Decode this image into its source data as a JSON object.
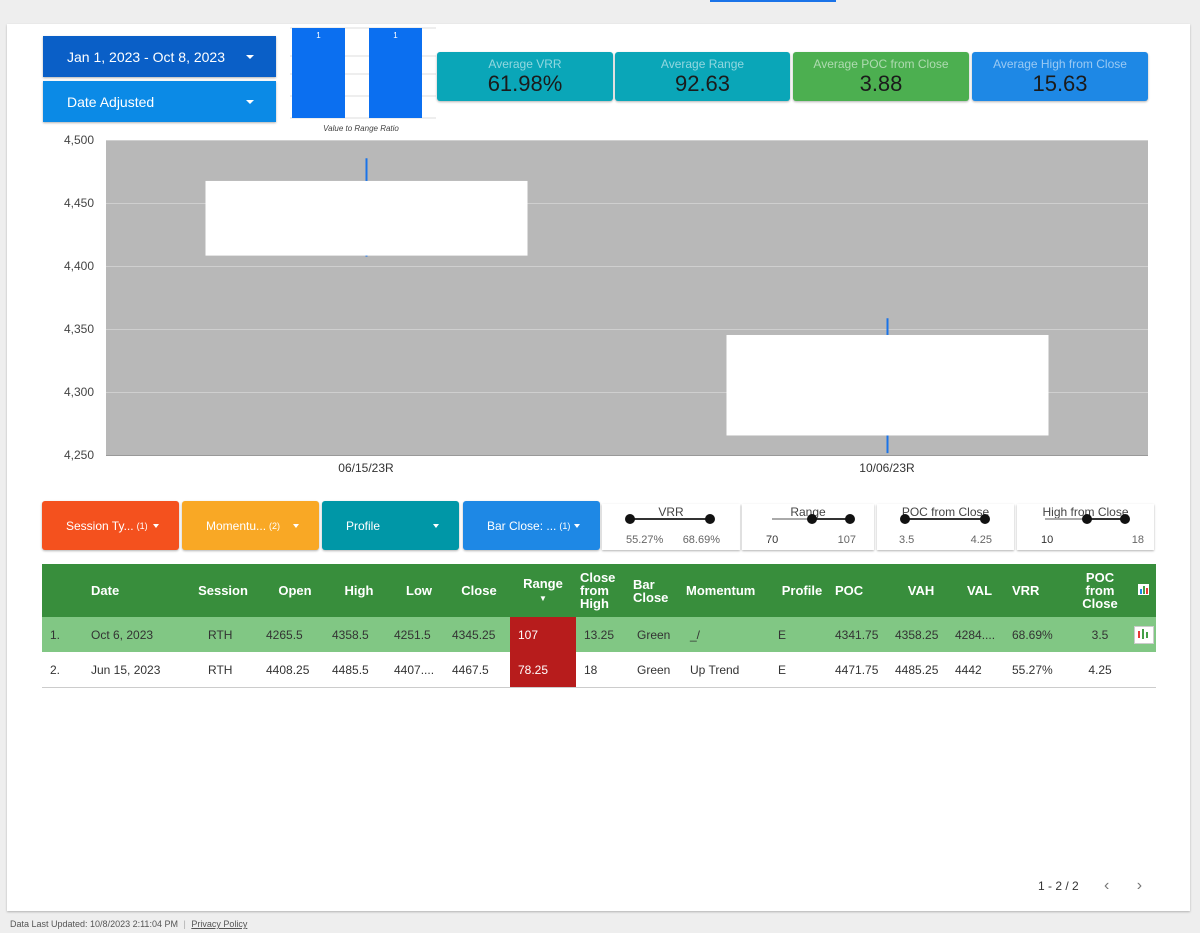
{
  "date_range": {
    "label": "Jan 1, 2023 - Oct 8, 2023"
  },
  "date_adjusted": {
    "label": "Date Adjusted"
  },
  "mini_chart": {
    "caption": "Value to Range Ratio",
    "bars": [
      {
        "label": "1",
        "value": 1
      },
      {
        "label": "1",
        "value": 1
      }
    ],
    "color": "#0b6ff0"
  },
  "kpis": [
    {
      "label": "Average VRR",
      "value": "61.98%",
      "color": "#0aa6b8"
    },
    {
      "label": "Average Range",
      "value": "92.63",
      "color": "#0aa6b8"
    },
    {
      "label": "Average POC from Close",
      "value": "3.88",
      "color": "#4caf50"
    },
    {
      "label": "Average High from Close",
      "value": "15.63",
      "color": "#1e88e5"
    }
  ],
  "chart_data": {
    "type": "candlestick",
    "categories": [
      "06/15/23R",
      "10/06/23R"
    ],
    "candles": [
      {
        "x": "06/15/23R",
        "open": 4408.25,
        "high": 4485.5,
        "low": 4407.5,
        "close": 4467.5
      },
      {
        "x": "10/06/23R",
        "open": 4265.5,
        "high": 4358.5,
        "low": 4251.5,
        "close": 4345.25
      }
    ],
    "yticks": [
      "4,500",
      "4,450",
      "4,400",
      "4,350",
      "4,300",
      "4,250"
    ],
    "ylim": [
      4250,
      4500
    ],
    "background": "#b8b8b8",
    "body_color": "#ffffff",
    "wick_color": "#1a73e8",
    "grid": true
  },
  "filters": [
    {
      "label": "Session Ty...",
      "count": "(1)",
      "color": "#f4511e"
    },
    {
      "label": "Momentu...",
      "count": "(2)",
      "color": "#f9a825"
    },
    {
      "label": "Profile",
      "count": "",
      "color": "#0097a7"
    },
    {
      "label": "Bar Close: ...",
      "count": "(1)",
      "color": "#1e88e5"
    }
  ],
  "sliders": [
    {
      "title": "VRR",
      "min": "55.27%",
      "max": "68.69%",
      "low_frac": 0.0,
      "high_frac": 1.0
    },
    {
      "title": "Range",
      "min": "70",
      "max": "107",
      "low_frac": 0.5,
      "high_frac": 1.0
    },
    {
      "title": "POC from Close",
      "min": "3.5",
      "max": "4.25",
      "low_frac": 0.0,
      "high_frac": 1.0
    },
    {
      "title": "High from Close",
      "min": "10",
      "max": "18",
      "low_frac": 0.5,
      "high_frac": 1.0
    }
  ],
  "table": {
    "headers": [
      "",
      "Date",
      "Session",
      "Open",
      "High",
      "Low",
      "Close",
      "Range",
      "Close from High",
      "Bar Close",
      "Momentum",
      "Profile",
      "POC",
      "VAH",
      "VAL",
      "VRR",
      "POC from Close",
      ""
    ],
    "rows": [
      [
        "1.",
        "Oct 6, 2023",
        "RTH",
        "4265.5",
        "4358.5",
        "4251.5",
        "4345.25",
        "107",
        "13.25",
        "Green",
        "_/",
        "E",
        "4341.75",
        "4358.25",
        "4284....",
        "68.69%",
        "3.5"
      ],
      [
        "2.",
        "Jun 15, 2023",
        "RTH",
        "4408.25",
        "4485.5",
        "4407....",
        "4467.5",
        "78.25",
        "18",
        "Green",
        "Up Trend",
        "E",
        "4471.75",
        "4485.25",
        "4442",
        "55.27%",
        "4.25"
      ]
    ]
  },
  "pagination": {
    "label": "1 - 2 / 2"
  },
  "footer": {
    "updated": "Data Last Updated: 10/8/2023 2:11:04 PM",
    "privacy": "Privacy Policy"
  }
}
